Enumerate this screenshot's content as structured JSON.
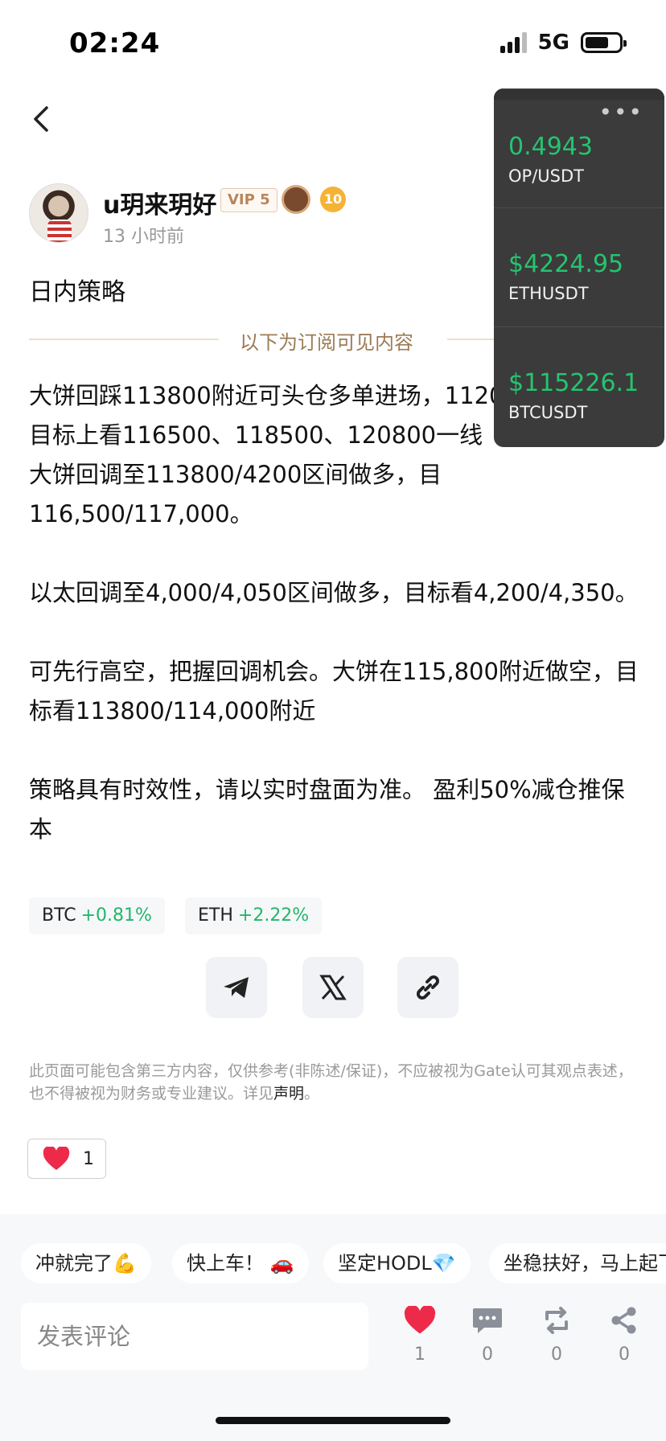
{
  "status_bar": {
    "time": "02:24",
    "network": "5G"
  },
  "author": {
    "name": "u玥来玥好",
    "vip": "VIP 5",
    "badge_level": "10",
    "time": "13 小时前"
  },
  "post": {
    "title": "日内策略",
    "divider": "以下为订阅可见内容",
    "paragraphs": [
      "大饼回踩113800附近可头仓多单进场，112000加仓多、目标上看116500、118500、120800一线\n大饼回调至113800/4200区间做多，目116,500/117,000。",
      "以太回调至4,000/4,050区间做多，目标看4,200/4,350。",
      "可先行高空，把握回调机会。大饼在115,800附近做空，目标看113800/114,000附近",
      "策略具有时效性，请以实时盘面为准。 盈利50%减仓推保本"
    ]
  },
  "coins": [
    {
      "symbol": "BTC",
      "change": "+0.81%"
    },
    {
      "symbol": "ETH",
      "change": "+2.22%"
    }
  ],
  "share": {
    "icons": [
      "telegram-icon",
      "x-icon",
      "link-icon"
    ]
  },
  "disclaimer": {
    "text": "此页面可能包含第三方内容，仅供参考(非陈述/保证)，不应被视为Gate认可其观点表述，也不得被视为财务或专业建议。详见",
    "link": "声明",
    "end": "。"
  },
  "like": {
    "count": "1"
  },
  "quick_replies": [
    "冲就完了💪",
    "快上车！ 🚗",
    "坚定HODL💎",
    "坐稳扶好，马上起飞"
  ],
  "comment": {
    "placeholder": "发表评论"
  },
  "actions": {
    "like": "1",
    "comments": "0",
    "repost": "0",
    "share": "0"
  },
  "ticker": [
    {
      "price": "0.4943",
      "pair": "OP/USDT"
    },
    {
      "price": "$4224.95",
      "pair": "ETHUSDT"
    },
    {
      "price": "$115226.1",
      "pair": "BTCUSDT"
    }
  ],
  "colors": {
    "up_green": "#22b76a",
    "heart_red": "#ee2a4a",
    "ticker_bg": "#3b3b3b"
  }
}
